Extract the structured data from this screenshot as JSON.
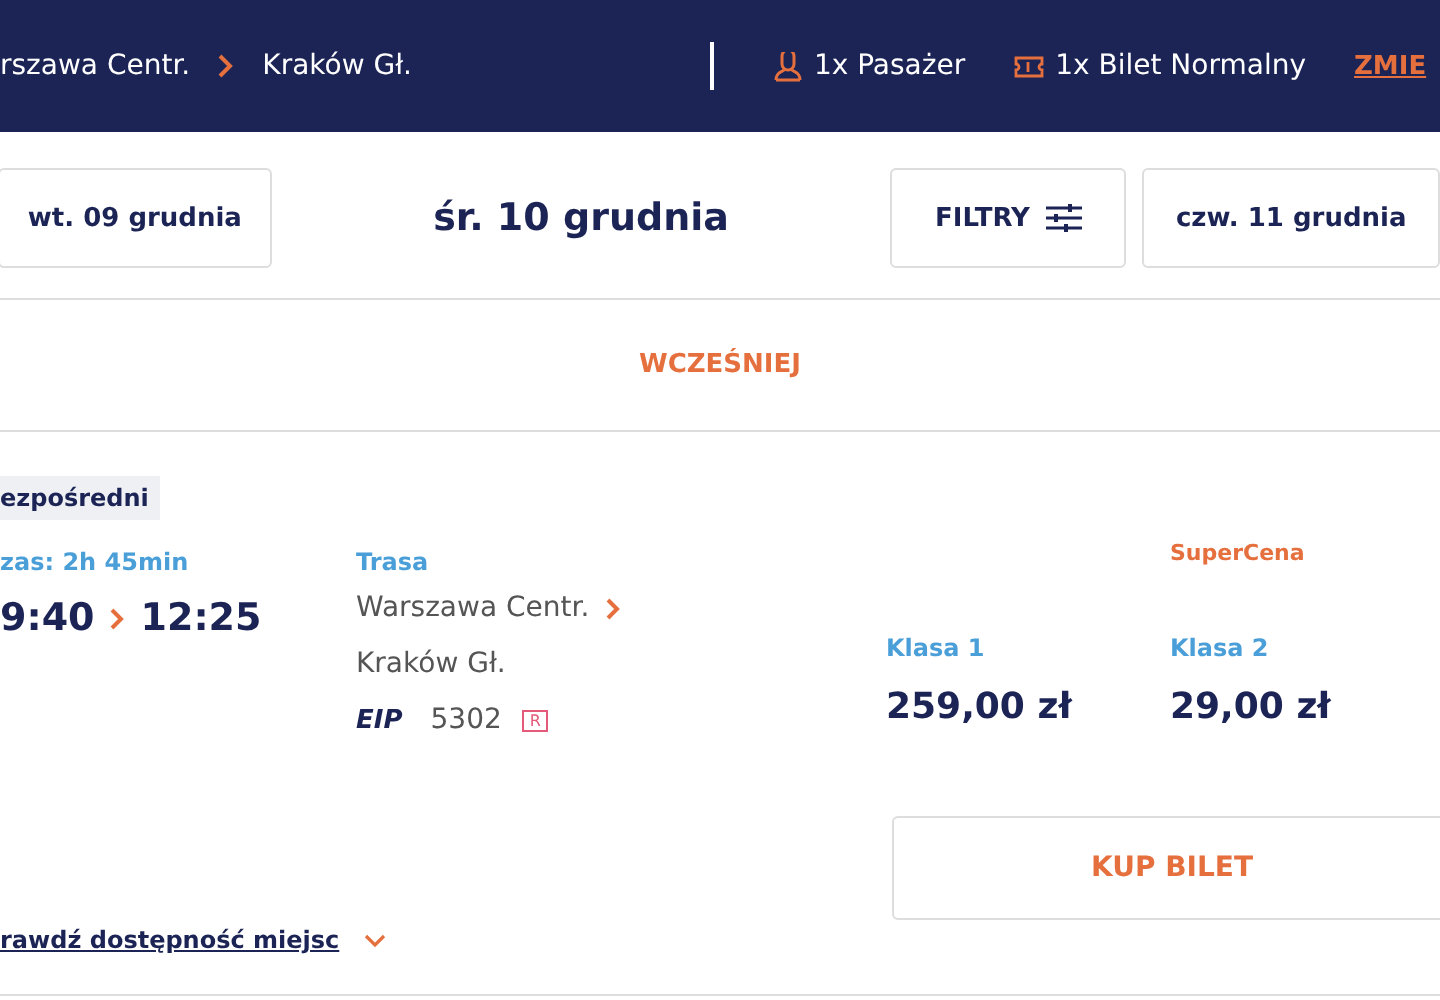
{
  "header": {
    "from": "rszawa Centr.",
    "to": "Kraków Gł.",
    "passengers": "1x Pasażer",
    "ticket": "1x Bilet Normalny",
    "change": "ZMIE"
  },
  "dates": {
    "previous": "wt. 09 grudnia",
    "current": "śr. 10 grudnia",
    "filters": "FILTRY",
    "next": "czw. 11 grudnia"
  },
  "earlier": "WCZEŚNIEJ",
  "connection": {
    "badge": "ezpośredni",
    "duration": "zas: 2h 45min",
    "departure": "9:40",
    "arrival": "12:25",
    "route_label": "Trasa",
    "route_from": "Warszawa Centr.",
    "route_to": "Kraków Gł.",
    "carrier": "EIP",
    "train_number": "5302",
    "reservation": "R",
    "fares": [
      {
        "class": "Klasa 1",
        "price": "259,00 zł"
      },
      {
        "promo": "SuperCena",
        "class": "Klasa 2",
        "price": "29,00 zł"
      }
    ],
    "buy": "KUP BILET",
    "seats_link": "rawdź dostępność miejsc"
  }
}
